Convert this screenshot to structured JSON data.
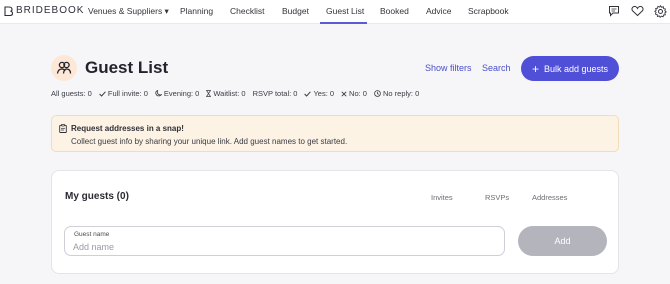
{
  "brand": {
    "name": "BRIDEBOOK"
  },
  "nav": {
    "items": [
      {
        "label": "Venues & Suppliers ▾"
      },
      {
        "label": "Planning"
      },
      {
        "label": "Checklist"
      },
      {
        "label": "Budget"
      },
      {
        "label": "Guest List"
      },
      {
        "label": "Booked"
      },
      {
        "label": "Advice"
      },
      {
        "label": "Scrapbook"
      }
    ],
    "active": "Guest List",
    "icons": [
      "chat-icon",
      "heart-icon",
      "settings-icon"
    ]
  },
  "header": {
    "title": "Guest List",
    "show_filters": "Show filters",
    "search": "Search",
    "bulk_add": "Bulk add guests",
    "plus": "+"
  },
  "stats": {
    "all_guests": "All guests: 0",
    "full_invite": "Full invite: 0",
    "evening": "Evening: 0",
    "waitlist": "Waitlist: 0",
    "rsvp_total": "RSVP total: 0",
    "yes": "Yes: 0",
    "no": "No: 0",
    "no_reply": "No reply: 0"
  },
  "notice": {
    "title": "Request addresses in a snap!",
    "body": "Collect guest info by sharing your unique link. Add guest names to get started."
  },
  "guests_card": {
    "title": "My guests (0)",
    "columns": [
      "Invites",
      "RSVPs",
      "Addresses"
    ],
    "input_label": "Guest name",
    "input_placeholder": "Add name",
    "input_value": "",
    "add_button": "Add"
  },
  "colors": {
    "accent": "#4f4fd8",
    "notice_bg": "#fdf3e4",
    "avatar_bg": "#fde7d7",
    "disabled_button": "#b4b4bd"
  }
}
